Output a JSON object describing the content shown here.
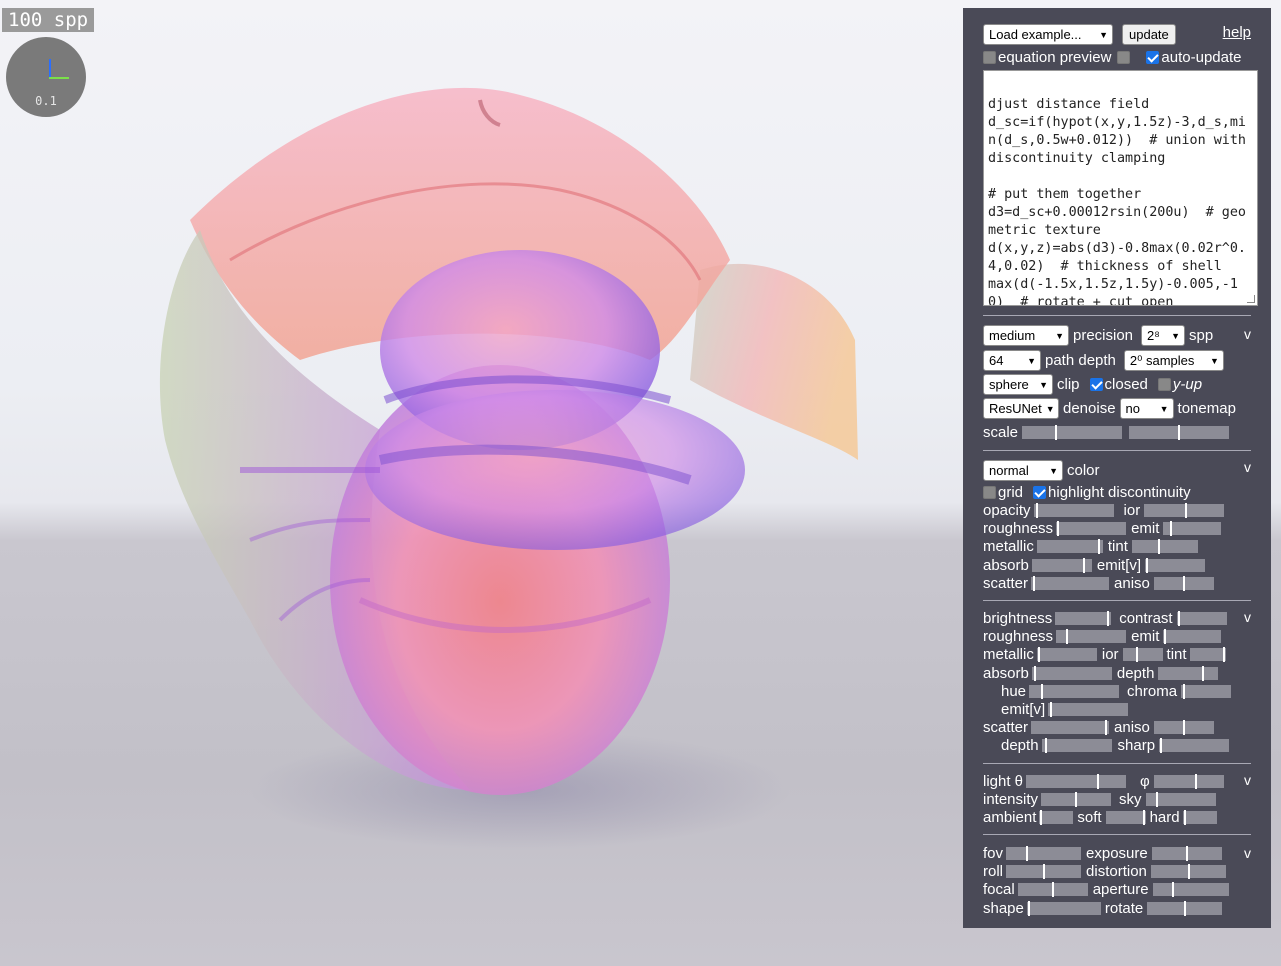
{
  "canvas": {
    "spp_badge": "100 spp",
    "axis_scale": "0.1"
  },
  "toolbar": {
    "load_example": "Load example...",
    "update_label": "update",
    "help_label": "help",
    "equation_preview_label": "equation preview",
    "equation_preview_checked": false,
    "extra_checkbox_checked": false,
    "auto_update_label": "auto-update",
    "auto_update_checked": true
  },
  "editor": {
    "text": "djust distance field\nd_sc=if(hypot(x,y,1.5z)-3,d_s,min(d_s,0.5w+0.012))  # union with discontinuity clamping\n\n# put them together\nd3=d_sc+0.00012rsin(200u)  # geometric texture\nd(x,y,z)=abs(d3)-0.8max(0.02r^0.4,0.02)  # thickness of shell\nmax(d(-1.5x,1.5z,1.5y)-0.005,-10)  # rotate + cut open"
  },
  "render": {
    "precision_value": "medium",
    "precision_label": "precision",
    "spp_value": "2⁸",
    "spp_label": "spp",
    "path_depth_value": "64",
    "path_depth_label": "path depth",
    "samples_value": "2⁰ samples",
    "clip_value": "sphere",
    "clip_label": "clip",
    "closed_label": "closed",
    "closed_checked": true,
    "yup_label": "y-up",
    "yup_checked": false,
    "denoise_value": "ResUNet",
    "denoise_label": "denoise",
    "tonemap_value": "no",
    "tonemap_label": "tonemap",
    "scale_label": "scale",
    "scale_sliders": [
      0.34,
      0.5
    ],
    "toggle": "v"
  },
  "material": {
    "color_value": "normal",
    "color_label": "color",
    "grid_label": "grid",
    "grid_checked": false,
    "highlight_label": "highlight discontinuity",
    "highlight_checked": true,
    "toggle": "v",
    "rows": [
      {
        "a_label": "opacity",
        "a_val": 0.02,
        "b_label": "ior",
        "b_val": 0.52
      },
      {
        "a_label": "roughness",
        "a_val": 0.02,
        "b_label": "emit",
        "b_val": 0.12
      },
      {
        "a_label": "metallic",
        "a_val": 0.96,
        "b_label": "tint",
        "b_val": 0.4
      },
      {
        "a_label": "absorb",
        "a_val": 0.88,
        "b_label": "emit[v]",
        "b_val": 0.02
      },
      {
        "a_label": "scatter",
        "a_val": 0.02,
        "b_label": "aniso",
        "b_val": 0.5
      }
    ]
  },
  "shading": {
    "toggle": "v",
    "rows": [
      {
        "a_label": "brightness",
        "a_val": 0.97,
        "b_label": "contrast",
        "b_val": 0.02
      },
      {
        "a_label": "roughness",
        "a_val": 0.15,
        "b_label": "emit",
        "b_val": 0.02
      },
      {
        "a_label": "metallic",
        "a_val": 0.02,
        "b_label": "ior",
        "b_val": 0.33,
        "c_label": "tint",
        "c_val": 0.97
      },
      {
        "a_label": "absorb",
        "a_val": 0.02,
        "b_label": "depth",
        "b_val": 0.75
      },
      {
        "a_label": "hue",
        "a_val": 0.14,
        "b_label": "chroma",
        "b_val": 0.04
      },
      {
        "a_label": "emit[v]",
        "a_val": 0.02
      },
      {
        "a_label": "scatter",
        "a_val": 0.97,
        "b_label": "aniso",
        "b_val": 0.5
      },
      {
        "a_label": "depth",
        "a_val": 0.04,
        "b_label": "sharp",
        "b_val": 0.02
      }
    ]
  },
  "lighting": {
    "toggle": "v",
    "rows": [
      {
        "a_label": "light θ",
        "a_val": 0.72,
        "b_label": "φ",
        "b_val": 0.6
      },
      {
        "a_label": "intensity",
        "a_val": 0.5,
        "b_label": "sky",
        "b_val": 0.14
      },
      {
        "a_label": "ambient",
        "a_val": 0.02,
        "b_label": "soft",
        "b_val": 0.97,
        "c_label": "hard",
        "c_val": 0.02
      }
    ]
  },
  "camera": {
    "toggle": "v",
    "rows": [
      {
        "a_label": "fov",
        "a_val": 0.28,
        "b_label": "exposure",
        "b_val": 0.5
      },
      {
        "a_label": "roll",
        "a_val": 0.5,
        "b_label": "distortion",
        "b_val": 0.5
      },
      {
        "a_label": "focal",
        "a_val": 0.5,
        "b_label": "aperture",
        "b_val": 0.25
      },
      {
        "a_label": "shape",
        "a_val": 0.02,
        "b_label": "rotate",
        "b_val": 0.5
      }
    ]
  }
}
